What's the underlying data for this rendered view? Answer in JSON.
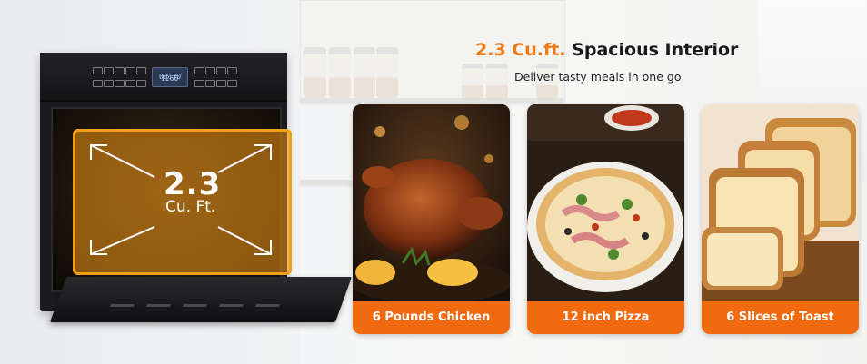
{
  "oven": {
    "display_time": "08:30",
    "display_temp": "1260",
    "capacity_value": "2.3",
    "capacity_unit": "Cu. Ft."
  },
  "header": {
    "title_accent": "2.3 Cu.ft.",
    "title_rest": "Spacious Interior",
    "subtitle": "Deliver tasty meals in one go"
  },
  "cards": [
    {
      "label": "6 Pounds Chicken",
      "image": "roast-chicken"
    },
    {
      "label": "12 inch Pizza",
      "image": "pizza"
    },
    {
      "label": "6 Slices of Toast",
      "image": "bread-loaf"
    }
  ],
  "colors": {
    "accent": "#f26a0f",
    "title_accent": "#f07a12",
    "capacity_box": "#f2a011",
    "oven_body": "#1b1b1d"
  }
}
